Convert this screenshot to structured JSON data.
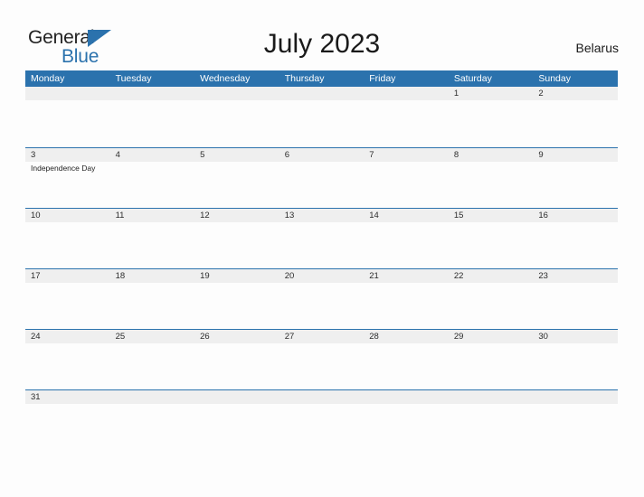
{
  "header": {
    "logo": {
      "text_top": "General",
      "text_bottom": "Blue",
      "flag_icon": "blue-flag-triangle",
      "color_top": "#232323",
      "color_bottom": "#2b72ad"
    },
    "title": "July 2023",
    "region": "Belarus"
  },
  "calendar": {
    "accent_color": "#2b72ad",
    "date_band_color": "#efefef",
    "weekdays": [
      "Monday",
      "Tuesday",
      "Wednesday",
      "Thursday",
      "Friday",
      "Saturday",
      "Sunday"
    ],
    "weeks": [
      {
        "days": [
          {
            "date": "",
            "event": ""
          },
          {
            "date": "",
            "event": ""
          },
          {
            "date": "",
            "event": ""
          },
          {
            "date": "",
            "event": ""
          },
          {
            "date": "",
            "event": ""
          },
          {
            "date": "1",
            "event": ""
          },
          {
            "date": "2",
            "event": ""
          }
        ]
      },
      {
        "days": [
          {
            "date": "3",
            "event": "Independence Day"
          },
          {
            "date": "4",
            "event": ""
          },
          {
            "date": "5",
            "event": ""
          },
          {
            "date": "6",
            "event": ""
          },
          {
            "date": "7",
            "event": ""
          },
          {
            "date": "8",
            "event": ""
          },
          {
            "date": "9",
            "event": ""
          }
        ]
      },
      {
        "days": [
          {
            "date": "10",
            "event": ""
          },
          {
            "date": "11",
            "event": ""
          },
          {
            "date": "12",
            "event": ""
          },
          {
            "date": "13",
            "event": ""
          },
          {
            "date": "14",
            "event": ""
          },
          {
            "date": "15",
            "event": ""
          },
          {
            "date": "16",
            "event": ""
          }
        ]
      },
      {
        "days": [
          {
            "date": "17",
            "event": ""
          },
          {
            "date": "18",
            "event": ""
          },
          {
            "date": "19",
            "event": ""
          },
          {
            "date": "20",
            "event": ""
          },
          {
            "date": "21",
            "event": ""
          },
          {
            "date": "22",
            "event": ""
          },
          {
            "date": "23",
            "event": ""
          }
        ]
      },
      {
        "days": [
          {
            "date": "24",
            "event": ""
          },
          {
            "date": "25",
            "event": ""
          },
          {
            "date": "26",
            "event": ""
          },
          {
            "date": "27",
            "event": ""
          },
          {
            "date": "28",
            "event": ""
          },
          {
            "date": "29",
            "event": ""
          },
          {
            "date": "30",
            "event": ""
          }
        ]
      },
      {
        "days": [
          {
            "date": "31",
            "event": ""
          },
          {
            "date": "",
            "event": ""
          },
          {
            "date": "",
            "event": ""
          },
          {
            "date": "",
            "event": ""
          },
          {
            "date": "",
            "event": ""
          },
          {
            "date": "",
            "event": ""
          },
          {
            "date": "",
            "event": ""
          }
        ]
      }
    ]
  }
}
